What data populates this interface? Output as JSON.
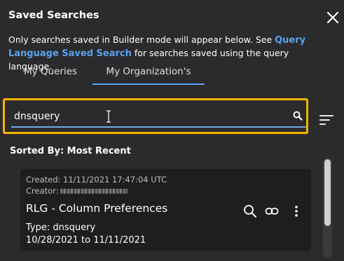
{
  "dialog": {
    "title": "Saved Searches",
    "description_prefix": "Only searches saved in Builder mode will appear below. See ",
    "description_link": "Query Language Saved Search",
    "description_suffix": " for searches saved using the query language."
  },
  "tabs": [
    {
      "label": "My Queries",
      "selected": false
    },
    {
      "label": "My Organization's",
      "selected": true
    }
  ],
  "search": {
    "value": "dnsquery",
    "placeholder": "",
    "highlight_color": "#f5b400"
  },
  "sort": {
    "label": "Sorted By: Most Recent"
  },
  "results": [
    {
      "created": "Created: 11/11/2021 17:47:04 UTC",
      "creator_label": "Creator:",
      "title": "RLG - Column Preferences",
      "type": "Type: dnsquery",
      "date_range": "10/28/2021 to 11/11/2021"
    }
  ],
  "icons": {
    "close": "close-icon",
    "search": "search-icon",
    "sort": "sort-icon",
    "link": "link-icon",
    "more": "more-vert-icon",
    "cursor": "text-cursor-icon"
  },
  "colors": {
    "background": "#2b2b2d",
    "card": "#1e1e1f",
    "accent": "#5aa2f0"
  }
}
